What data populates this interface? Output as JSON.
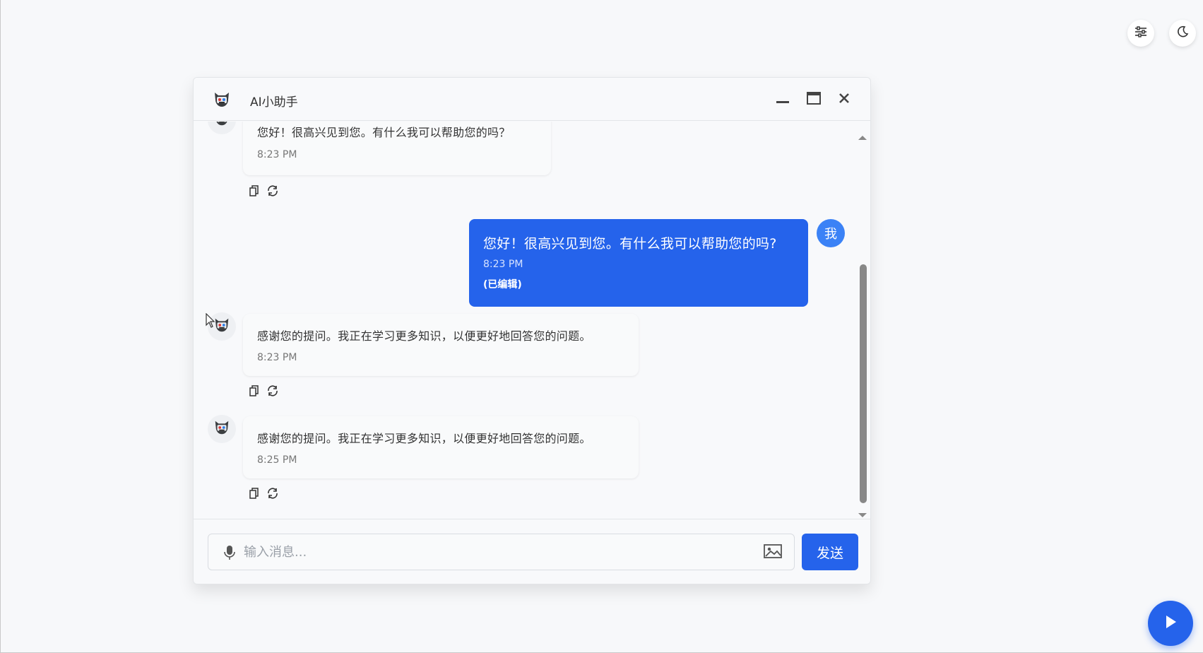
{
  "window": {
    "title": "AI小助手",
    "minimize_icon": "minimize-icon",
    "maximize_icon": "maximize-icon",
    "close_icon": "close-icon"
  },
  "top_controls": [
    {
      "icon": "sliders-icon"
    },
    {
      "icon": "moon-icon"
    }
  ],
  "messages": [
    {
      "role": "bot",
      "text": "您好！很高兴见到您。有什么我可以帮助您的吗？",
      "time": "8:23 PM"
    },
    {
      "role": "user",
      "avatar_label": "我",
      "text": "您好！很高兴见到您。有什么我可以帮助您的吗?",
      "time": "8:23 PM",
      "edited": "(已编辑)"
    },
    {
      "role": "bot",
      "text": "感谢您的提问。我正在学习更多知识，以便更好地回答您的问题。",
      "time": "8:23 PM"
    },
    {
      "role": "bot",
      "text": "感谢您的提问。我正在学习更多知识，以便更好地回答您的问题。",
      "time": "8:25 PM"
    }
  ],
  "composer": {
    "placeholder": "输入消息...",
    "send_label": "发送",
    "mic_icon": "microphone-icon",
    "image_icon": "image-icon"
  },
  "fab_icon": "play-icon",
  "colors": {
    "accent": "#2563eb",
    "user_avatar": "#3b82f6",
    "background": "#f7f8fa"
  }
}
